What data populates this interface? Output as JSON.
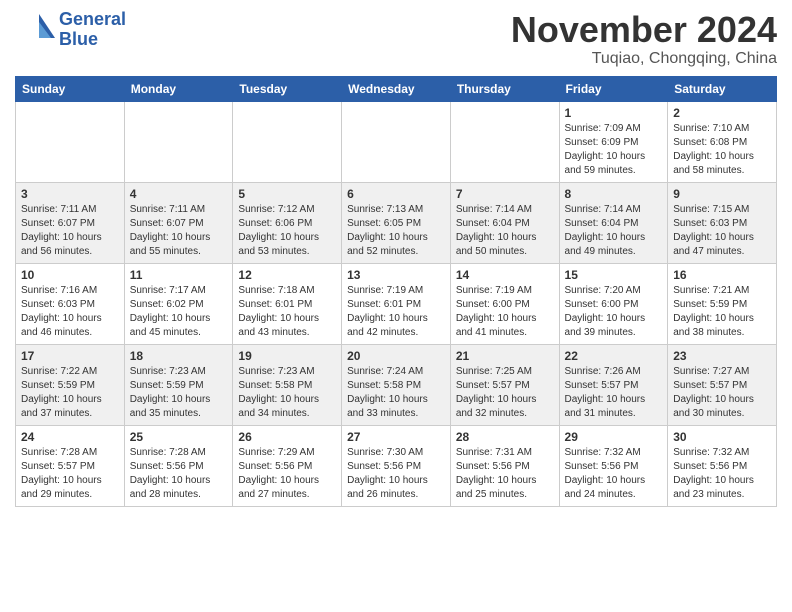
{
  "header": {
    "logo_line1": "General",
    "logo_line2": "Blue",
    "month_title": "November 2024",
    "location": "Tuqiao, Chongqing, China"
  },
  "days_of_week": [
    "Sunday",
    "Monday",
    "Tuesday",
    "Wednesday",
    "Thursday",
    "Friday",
    "Saturday"
  ],
  "weeks": [
    [
      {
        "day": "",
        "info": ""
      },
      {
        "day": "",
        "info": ""
      },
      {
        "day": "",
        "info": ""
      },
      {
        "day": "",
        "info": ""
      },
      {
        "day": "",
        "info": ""
      },
      {
        "day": "1",
        "info": "Sunrise: 7:09 AM\nSunset: 6:09 PM\nDaylight: 10 hours\nand 59 minutes."
      },
      {
        "day": "2",
        "info": "Sunrise: 7:10 AM\nSunset: 6:08 PM\nDaylight: 10 hours\nand 58 minutes."
      }
    ],
    [
      {
        "day": "3",
        "info": "Sunrise: 7:11 AM\nSunset: 6:07 PM\nDaylight: 10 hours\nand 56 minutes."
      },
      {
        "day": "4",
        "info": "Sunrise: 7:11 AM\nSunset: 6:07 PM\nDaylight: 10 hours\nand 55 minutes."
      },
      {
        "day": "5",
        "info": "Sunrise: 7:12 AM\nSunset: 6:06 PM\nDaylight: 10 hours\nand 53 minutes."
      },
      {
        "day": "6",
        "info": "Sunrise: 7:13 AM\nSunset: 6:05 PM\nDaylight: 10 hours\nand 52 minutes."
      },
      {
        "day": "7",
        "info": "Sunrise: 7:14 AM\nSunset: 6:04 PM\nDaylight: 10 hours\nand 50 minutes."
      },
      {
        "day": "8",
        "info": "Sunrise: 7:14 AM\nSunset: 6:04 PM\nDaylight: 10 hours\nand 49 minutes."
      },
      {
        "day": "9",
        "info": "Sunrise: 7:15 AM\nSunset: 6:03 PM\nDaylight: 10 hours\nand 47 minutes."
      }
    ],
    [
      {
        "day": "10",
        "info": "Sunrise: 7:16 AM\nSunset: 6:03 PM\nDaylight: 10 hours\nand 46 minutes."
      },
      {
        "day": "11",
        "info": "Sunrise: 7:17 AM\nSunset: 6:02 PM\nDaylight: 10 hours\nand 45 minutes."
      },
      {
        "day": "12",
        "info": "Sunrise: 7:18 AM\nSunset: 6:01 PM\nDaylight: 10 hours\nand 43 minutes."
      },
      {
        "day": "13",
        "info": "Sunrise: 7:19 AM\nSunset: 6:01 PM\nDaylight: 10 hours\nand 42 minutes."
      },
      {
        "day": "14",
        "info": "Sunrise: 7:19 AM\nSunset: 6:00 PM\nDaylight: 10 hours\nand 41 minutes."
      },
      {
        "day": "15",
        "info": "Sunrise: 7:20 AM\nSunset: 6:00 PM\nDaylight: 10 hours\nand 39 minutes."
      },
      {
        "day": "16",
        "info": "Sunrise: 7:21 AM\nSunset: 5:59 PM\nDaylight: 10 hours\nand 38 minutes."
      }
    ],
    [
      {
        "day": "17",
        "info": "Sunrise: 7:22 AM\nSunset: 5:59 PM\nDaylight: 10 hours\nand 37 minutes."
      },
      {
        "day": "18",
        "info": "Sunrise: 7:23 AM\nSunset: 5:59 PM\nDaylight: 10 hours\nand 35 minutes."
      },
      {
        "day": "19",
        "info": "Sunrise: 7:23 AM\nSunset: 5:58 PM\nDaylight: 10 hours\nand 34 minutes."
      },
      {
        "day": "20",
        "info": "Sunrise: 7:24 AM\nSunset: 5:58 PM\nDaylight: 10 hours\nand 33 minutes."
      },
      {
        "day": "21",
        "info": "Sunrise: 7:25 AM\nSunset: 5:57 PM\nDaylight: 10 hours\nand 32 minutes."
      },
      {
        "day": "22",
        "info": "Sunrise: 7:26 AM\nSunset: 5:57 PM\nDaylight: 10 hours\nand 31 minutes."
      },
      {
        "day": "23",
        "info": "Sunrise: 7:27 AM\nSunset: 5:57 PM\nDaylight: 10 hours\nand 30 minutes."
      }
    ],
    [
      {
        "day": "24",
        "info": "Sunrise: 7:28 AM\nSunset: 5:57 PM\nDaylight: 10 hours\nand 29 minutes."
      },
      {
        "day": "25",
        "info": "Sunrise: 7:28 AM\nSunset: 5:56 PM\nDaylight: 10 hours\nand 28 minutes."
      },
      {
        "day": "26",
        "info": "Sunrise: 7:29 AM\nSunset: 5:56 PM\nDaylight: 10 hours\nand 27 minutes."
      },
      {
        "day": "27",
        "info": "Sunrise: 7:30 AM\nSunset: 5:56 PM\nDaylight: 10 hours\nand 26 minutes."
      },
      {
        "day": "28",
        "info": "Sunrise: 7:31 AM\nSunset: 5:56 PM\nDaylight: 10 hours\nand 25 minutes."
      },
      {
        "day": "29",
        "info": "Sunrise: 7:32 AM\nSunset: 5:56 PM\nDaylight: 10 hours\nand 24 minutes."
      },
      {
        "day": "30",
        "info": "Sunrise: 7:32 AM\nSunset: 5:56 PM\nDaylight: 10 hours\nand 23 minutes."
      }
    ]
  ]
}
